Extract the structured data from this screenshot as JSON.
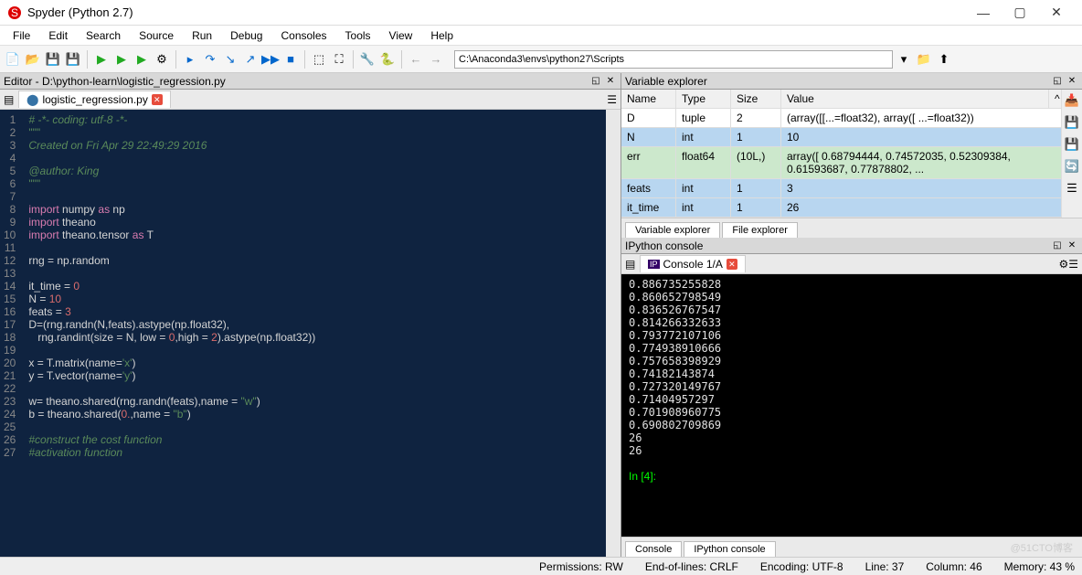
{
  "window": {
    "title": "Spyder (Python 2.7)"
  },
  "menu": [
    "File",
    "Edit",
    "Search",
    "Source",
    "Run",
    "Debug",
    "Consoles",
    "Tools",
    "View",
    "Help"
  ],
  "toolbar": {
    "path": "C:\\Anaconda3\\envs\\python27\\Scripts"
  },
  "editor_pane": {
    "title": "Editor - D:\\python-learn\\logistic_regression.py",
    "tab": {
      "label": "logistic_regression.py"
    }
  },
  "code": {
    "lines": [
      {
        "n": 1,
        "html": "<span class='c-comment'># -*- coding: utf-8 -*-</span>"
      },
      {
        "n": 2,
        "html": "<span class='c-str'>\"\"\"</span>"
      },
      {
        "n": 3,
        "html": "<span class='c-comment'>Created on Fri Apr 29 22:49:29 2016</span>"
      },
      {
        "n": 4,
        "html": ""
      },
      {
        "n": 5,
        "html": "<span class='c-comment'>@author: King</span>"
      },
      {
        "n": 6,
        "html": "<span class='c-str'>\"\"\"</span>"
      },
      {
        "n": 7,
        "html": ""
      },
      {
        "n": 8,
        "html": "<span class='c-kw'>import</span> numpy <span class='c-kw'>as</span> np"
      },
      {
        "n": 9,
        "html": "<span class='c-kw'>import</span> theano"
      },
      {
        "n": 10,
        "html": "<span class='c-kw'>import</span> theano.tensor <span class='c-kw'>as</span> T"
      },
      {
        "n": 11,
        "html": ""
      },
      {
        "n": 12,
        "html": "rng = np.random"
      },
      {
        "n": 13,
        "html": ""
      },
      {
        "n": 14,
        "html": "it_time = <span class='c-num'>0</span>"
      },
      {
        "n": 15,
        "html": "N = <span class='c-num'>10</span>"
      },
      {
        "n": 16,
        "html": "feats = <span class='c-num'>3</span>"
      },
      {
        "n": 17,
        "html": "D=(rng.randn(N,feats).astype(np.float32),"
      },
      {
        "n": 18,
        "html": "   rng.randint(size = N, low = <span class='c-num'>0</span>,high = <span class='c-num'>2</span>).astype(np.float32))"
      },
      {
        "n": 19,
        "html": ""
      },
      {
        "n": 20,
        "html": "x = T.matrix(name=<span class='c-str'>'x'</span>)"
      },
      {
        "n": 21,
        "html": "y = T.vector(name=<span class='c-str'>'y'</span>)"
      },
      {
        "n": 22,
        "html": ""
      },
      {
        "n": 23,
        "html": "w= theano.shared(rng.randn(feats),name = <span class='c-str'>\"w\"</span>)"
      },
      {
        "n": 24,
        "html": "b = theano.shared(<span class='c-num'>0.</span>,name = <span class='c-str'>\"b\"</span>)"
      },
      {
        "n": 25,
        "html": ""
      },
      {
        "n": 26,
        "html": "<span class='c-comment'>#construct the cost function</span>"
      },
      {
        "n": 27,
        "html": "<span class='c-comment'>#activation function</span>"
      }
    ]
  },
  "var_explorer": {
    "title": "Variable explorer",
    "headers": {
      "name": "Name",
      "type": "Type",
      "size": "Size",
      "value": "Value"
    },
    "rows": [
      {
        "name": "D",
        "type": "tuple",
        "size": "2",
        "value": "(array([[...=float32), array([ ...=float32))",
        "cls": ""
      },
      {
        "name": "N",
        "type": "int",
        "size": "1",
        "value": "10",
        "cls": "hl"
      },
      {
        "name": "err",
        "type": "float64",
        "size": "(10L,)",
        "value": "array([ 0.68794444,  0.74572035,  0.52309384,  0.61593687,  0.77878802, ...",
        "cls": "hl2"
      },
      {
        "name": "feats",
        "type": "int",
        "size": "1",
        "value": "3",
        "cls": "hl"
      },
      {
        "name": "it_time",
        "type": "int",
        "size": "1",
        "value": "26",
        "cls": "hl"
      }
    ],
    "tabs": [
      "Variable explorer",
      "File explorer"
    ]
  },
  "ipython": {
    "title": "IPython console",
    "tab": "Console 1/A",
    "output": [
      "0.886735255828",
      "0.860652798549",
      "0.836526767547",
      "0.814266332633",
      "0.793772107106",
      "0.774938910666",
      "0.757658398929",
      "0.74182143874",
      "0.727320149767",
      "0.71404957297",
      "0.701908960775",
      "0.690802709869",
      "26",
      "26"
    ],
    "prompt": "In [4]:",
    "tabs": [
      "Console",
      "IPython console"
    ]
  },
  "statusbar": {
    "perm": "Permissions: RW",
    "eol": "End-of-lines: CRLF",
    "enc": "Encoding: UTF-8",
    "line": "Line: 37",
    "col": "Column: 46",
    "mem": "Memory: 43 %"
  },
  "watermark": "@51CTO博客"
}
